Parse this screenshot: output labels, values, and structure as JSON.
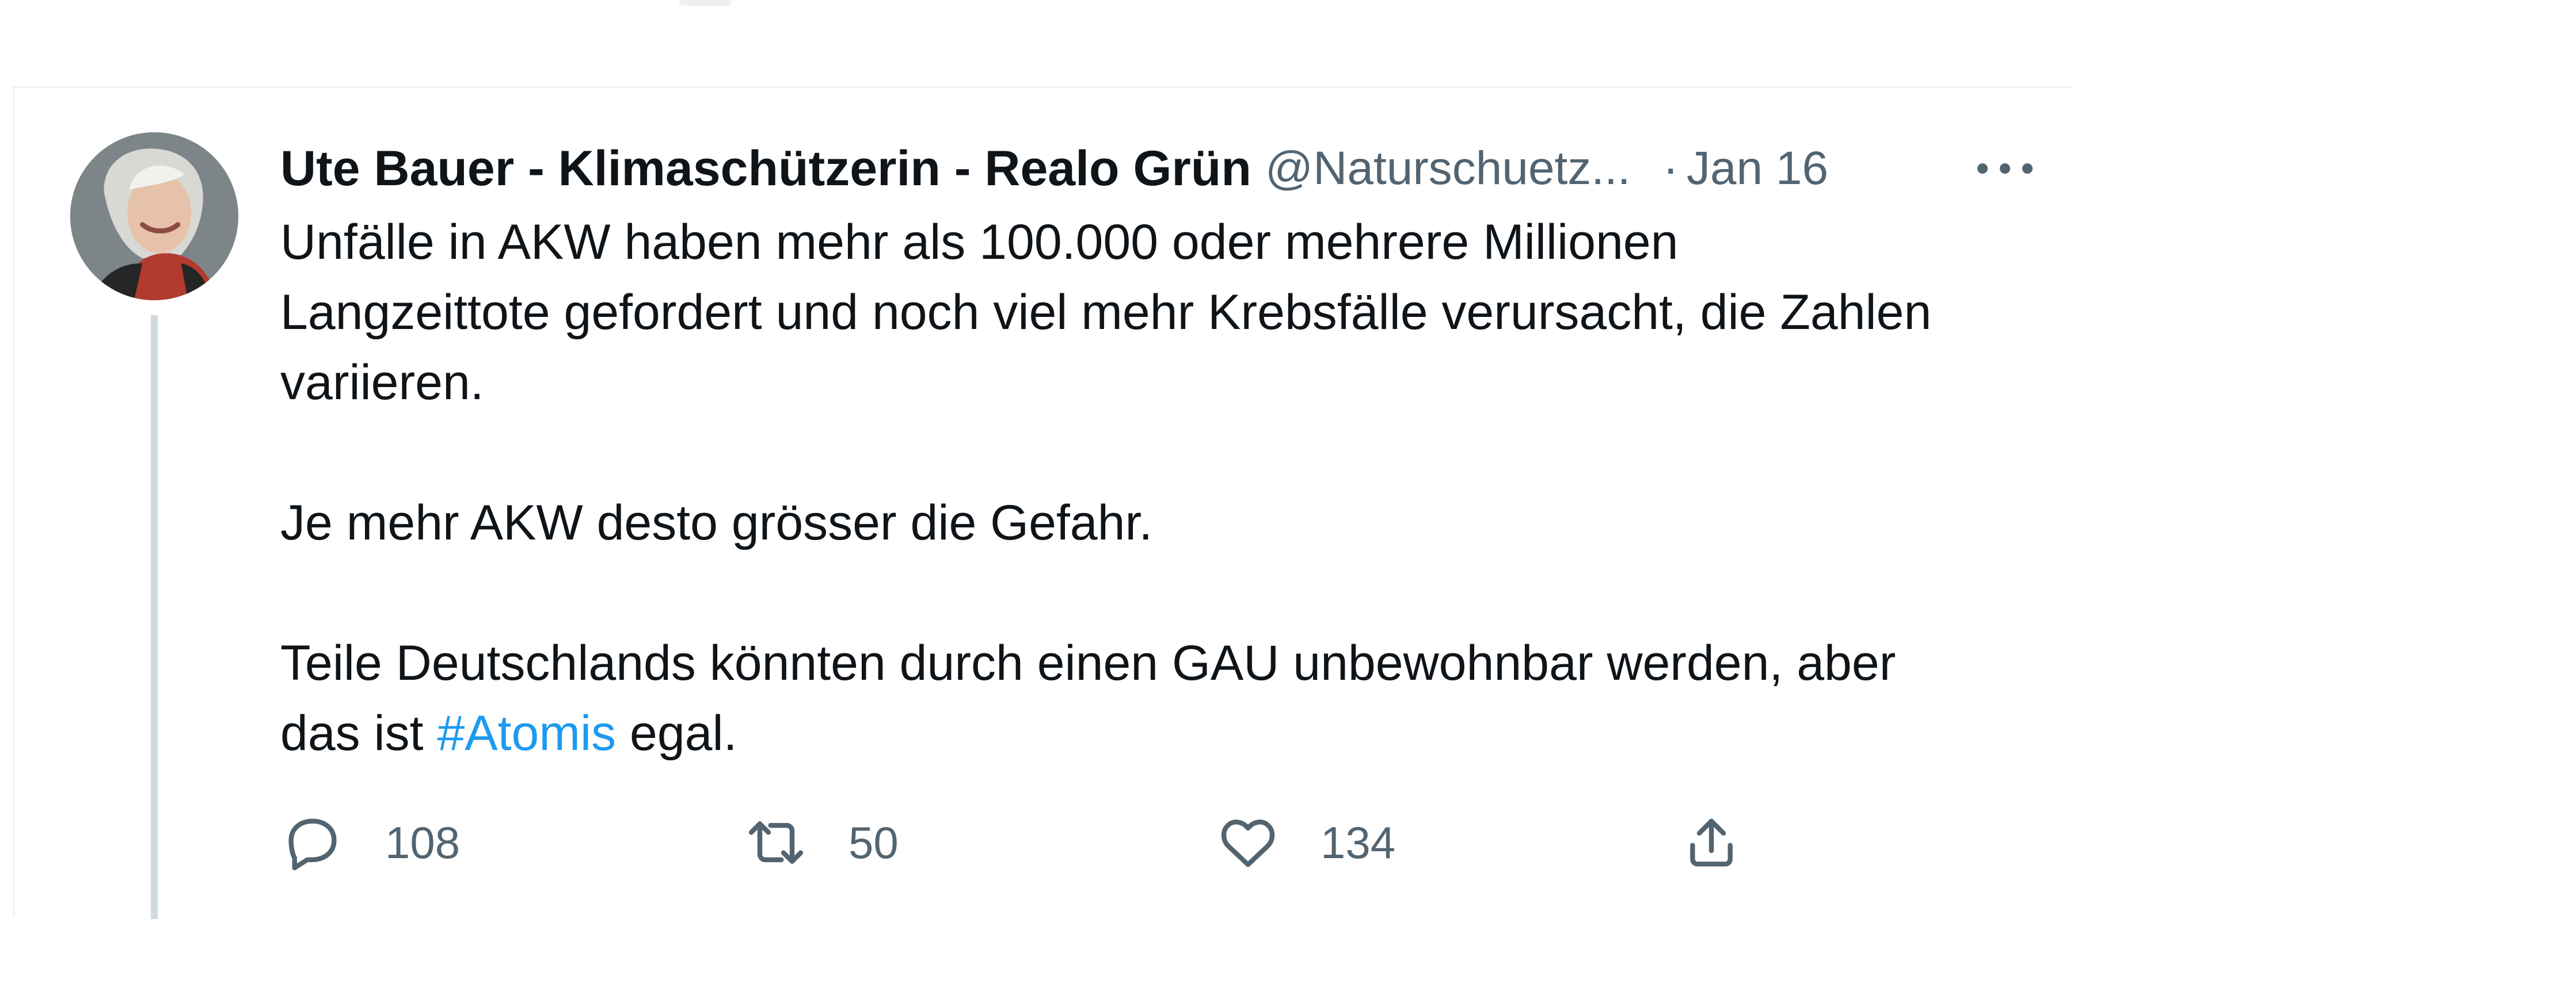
{
  "tweet": {
    "display_name": "Ute Bauer - Klimaschützerin - Realo Grün",
    "handle": "@Naturschuetz...",
    "separator": "·",
    "date": "Jan 16",
    "body": {
      "paragraph_1_line_1": "Unfälle in AKW haben mehr als 100.000 oder mehrere Millionen",
      "paragraph_1_line_2": "Langzeittote gefordert und noch viel mehr Krebsfälle verursacht, die Zahlen",
      "paragraph_1_line_3": "variieren.",
      "paragraph_2": "Je mehr AKW desto grösser die Gefahr.",
      "paragraph_3_line_1": "Teile Deutschlands könnten durch einen GAU unbewohnbar werden, aber",
      "paragraph_3_prefix": "das ist ",
      "hashtag": "#Atomis",
      "paragraph_3_suffix": " egal."
    },
    "actions": {
      "replies": "108",
      "retweets": "50",
      "likes": "134"
    },
    "icons": {
      "more": "more-horizontal-icon",
      "reply": "reply-icon",
      "retweet": "retweet-icon",
      "like": "heart-icon",
      "share": "share-icon"
    },
    "colors": {
      "text": "#0f1419",
      "secondary": "#536471",
      "link": "#1d9bf0",
      "thread_line": "#cfd9de"
    }
  }
}
